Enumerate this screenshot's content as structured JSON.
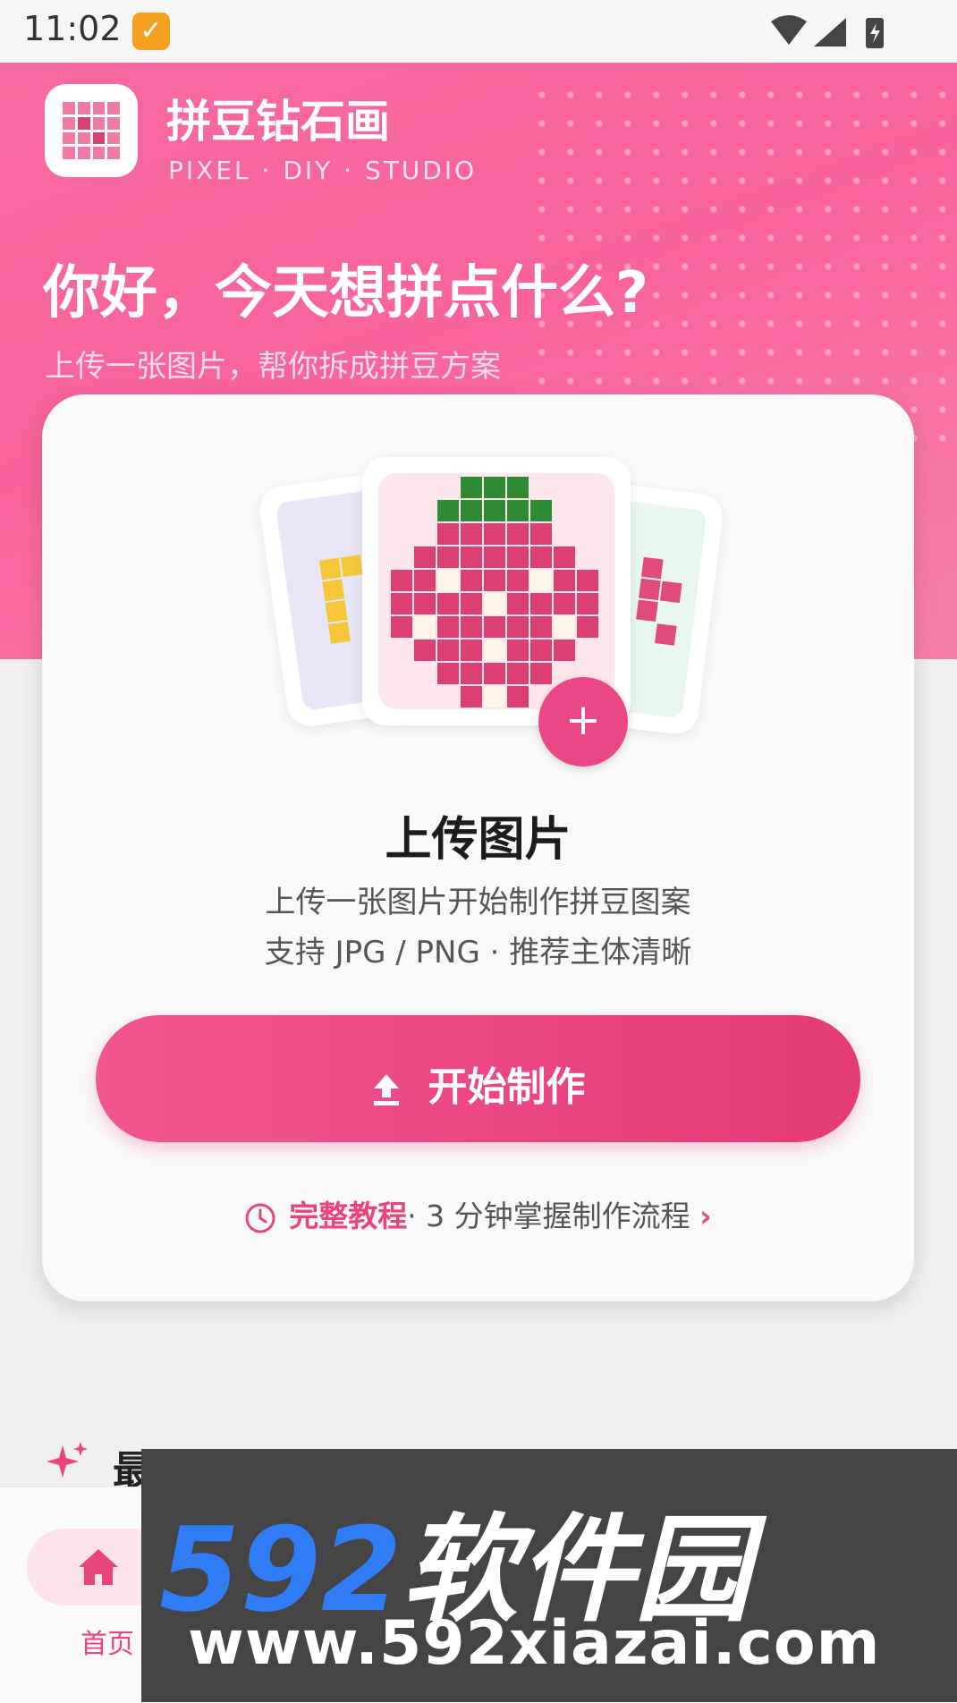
{
  "status_bar": {
    "time": "11:02"
  },
  "header": {
    "app_name": "拼豆钻石画",
    "app_subtitle": "PIXEL · DIY · STUDIO"
  },
  "hero": {
    "greeting": "你好，今天想拼点什么?",
    "subtext": "上传一张图片，帮你拆成拼豆方案"
  },
  "upload_card": {
    "title": "上传图片",
    "desc_line1": "上传一张图片开始制作拼豆图案",
    "desc_line2": "支持 JPG / PNG · 推荐主体清晰",
    "plus_label": "+",
    "start_button": "开始制作",
    "tutorial_link": "完整教程",
    "tutorial_text": "· 3 分钟掌握制作流程",
    "tutorial_chevron": "›"
  },
  "recent": {
    "title": "最近作品"
  },
  "bottom_nav": {
    "home_label": "首页"
  },
  "watermark": {
    "brand_num": "592",
    "brand_cn": "软件园",
    "url": "www.592xiazai.com"
  },
  "colors": {
    "accent": "#e94786",
    "hero_pink": "#f9639d",
    "strawberry_red": "#dc3f74",
    "leaf_green": "#2f8a34",
    "seed_cream": "#fdf6e6"
  },
  "icons": [
    "logo-grid-icon",
    "notification-check-icon",
    "wifi-icon",
    "signal-icon",
    "battery-icon",
    "upload-icon",
    "clock-icon",
    "sparkle-icon",
    "home-icon"
  ]
}
